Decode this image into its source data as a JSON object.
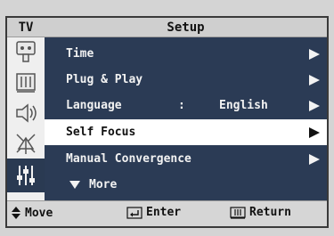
{
  "sidebar": {
    "tv_label": "TV"
  },
  "header": {
    "title": "Setup"
  },
  "menu": {
    "items": [
      {
        "label": "Time"
      },
      {
        "label": "Plug & Play"
      },
      {
        "label": "Language",
        "colon": ":",
        "value": "English"
      },
      {
        "label": "Self Focus"
      },
      {
        "label": "Manual Convergence"
      },
      {
        "label": "More"
      }
    ],
    "selected_index": 3
  },
  "footer": {
    "move": "Move",
    "enter": "Enter",
    "return": "Return"
  },
  "colors": {
    "menu_bg": "#2b3b55",
    "selected_bg": "#ffffff",
    "frame_bg": "#efefef"
  }
}
